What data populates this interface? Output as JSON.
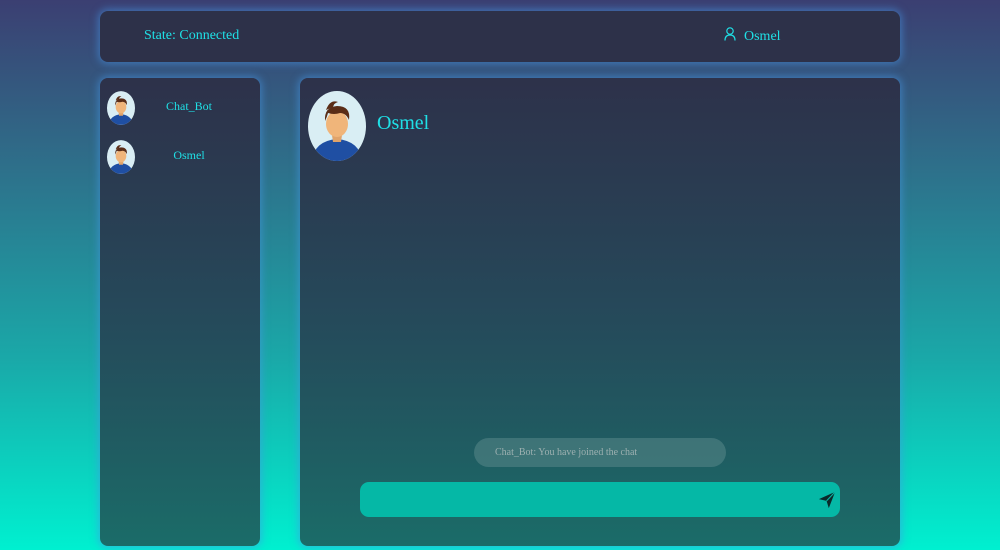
{
  "header": {
    "state_text": "State: Connected",
    "username": "Osmel",
    "user_icon": "user-icon"
  },
  "sidebar": {
    "contacts": [
      {
        "name": "Chat_Bot",
        "avatar": "avatar-icon"
      },
      {
        "name": "Osmel",
        "avatar": "avatar-icon"
      }
    ]
  },
  "chat": {
    "title": "Osmel",
    "messages": [
      {
        "text": "Chat_Bot: You have joined the chat"
      }
    ],
    "input": {
      "value": "",
      "placeholder": ""
    },
    "send_icon": "send-icon"
  },
  "colors": {
    "accent": "#1fe0e6",
    "input_bg": "#05b8a6",
    "panel_bg": "#2d3149"
  }
}
